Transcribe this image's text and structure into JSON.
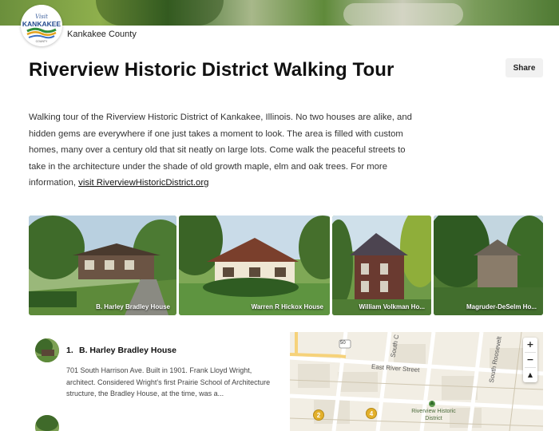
{
  "header": {
    "org_name": "Kankakee County",
    "logo": {
      "line1": "Visit",
      "line2": "KANKAKEE",
      "line3": "COUNTY"
    }
  },
  "page": {
    "title": "Riverview Historic District Walking Tour",
    "share_label": "Share",
    "description": "Walking tour of the Riverview Historic District of Kankakee, Illinois. No two houses are alike, and hidden gems are everywhere if one just takes a moment to look. The area is filled with custom homes, many over a century old that sit neatly on large lots. Come walk the peaceful streets to take in the architecture under the shade of old growth maple, elm and oak trees. For more information, ",
    "link_text": "visit RiverviewHistoricDistrict.org"
  },
  "photos": [
    {
      "caption": "B. Harley Bradley House"
    },
    {
      "caption": "Warren R Hickox House"
    },
    {
      "caption": "William Volkman Ho..."
    },
    {
      "caption": "Magruder-DeSelm Ho..."
    }
  ],
  "stops": [
    {
      "number": "1.",
      "name": "B. Harley Bradley House",
      "description": "701 South Harrison Ave. Built in 1901. Frank Lloyd Wright, architect. Considered Wright's first Prairie School of Architecture structure, the Bradley House, at the time, was a..."
    }
  ],
  "map": {
    "streets": {
      "east_river": "East River Street",
      "south_c": "South C",
      "south_roosevelt": "South Roosevelt",
      "route": "50"
    },
    "poi_label": "Riverview Historic District",
    "pins": [
      "2",
      "4"
    ],
    "zoom_in": "+",
    "zoom_out": "−",
    "compass": "▲"
  }
}
